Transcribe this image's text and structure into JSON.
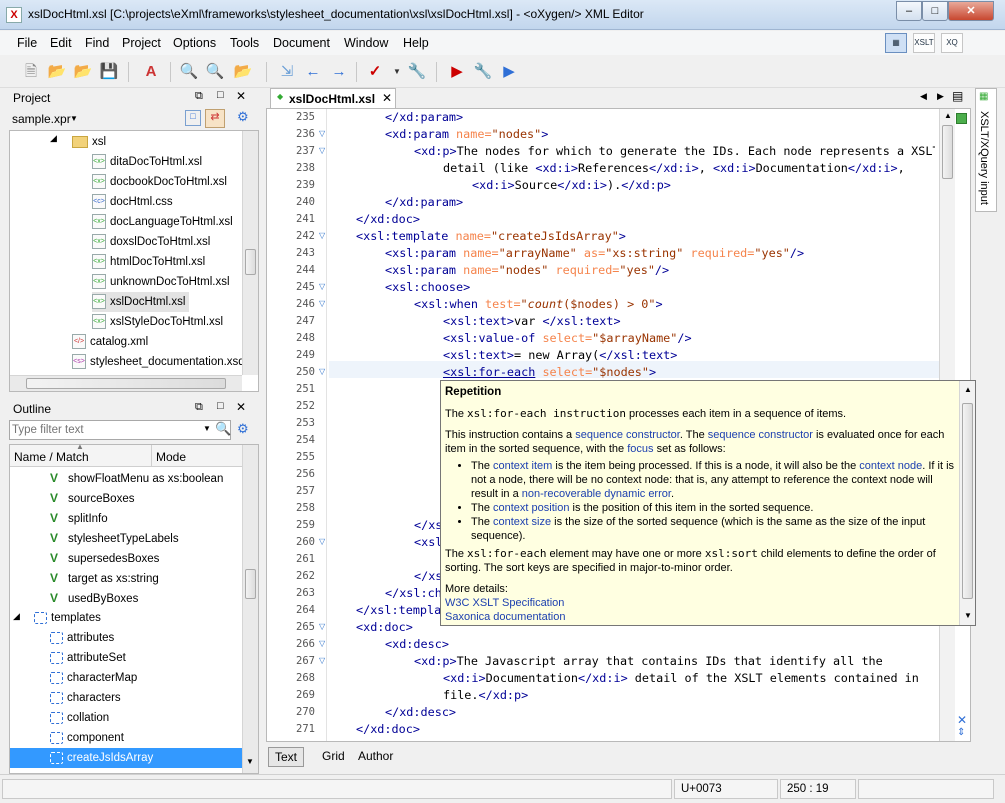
{
  "window": {
    "title": "xslDocHtml.xsl [C:\\projects\\eXml\\frameworks\\stylesheet_documentation\\xsl\\xslDocHtml.xsl] - <oXygen/> XML Editor",
    "app_icon": "x-logo-icon"
  },
  "menu": [
    "File",
    "Edit",
    "Find",
    "Project",
    "Options",
    "Tools",
    "Document",
    "Window",
    "Help"
  ],
  "perspectives": [
    "editor-perspective-icon",
    "XSLT",
    "XQ"
  ],
  "project": {
    "header": "Project",
    "file": "sample.xpr",
    "tree": [
      {
        "label": "xsl",
        "type": "folder"
      },
      {
        "label": "ditaDocToHtml.xsl",
        "type": "xsl"
      },
      {
        "label": "docbookDocToHtml.xsl",
        "type": "xsl"
      },
      {
        "label": "docHtml.css",
        "type": "css"
      },
      {
        "label": "docLanguageToHtml.xsl",
        "type": "xsl"
      },
      {
        "label": "doxslDocToHtml.xsl",
        "type": "xsl"
      },
      {
        "label": "htmlDocToHtml.xsl",
        "type": "xsl"
      },
      {
        "label": "unknownDocToHtml.xsl",
        "type": "xsl"
      },
      {
        "label": "xslDocHtml.xsl",
        "type": "xsl",
        "selected": true
      },
      {
        "label": "xslStyleDocToHtml.xsl",
        "type": "xsl"
      },
      {
        "label": "catalog.xml",
        "type": "xml"
      },
      {
        "label": "stylesheet_documentation.xsd",
        "type": "xsd"
      }
    ]
  },
  "outline": {
    "header": "Outline",
    "filter_placeholder": "Type filter text",
    "columns": [
      "Name / Match",
      "Mode"
    ],
    "items": [
      {
        "label": "showFloatMenu as xs:boolean",
        "type": "var"
      },
      {
        "label": "sourceBoxes",
        "type": "var"
      },
      {
        "label": "splitInfo",
        "type": "var"
      },
      {
        "label": "stylesheetTypeLabels",
        "type": "var"
      },
      {
        "label": "supersedesBoxes",
        "type": "var"
      },
      {
        "label": "target as xs:string",
        "type": "var"
      },
      {
        "label": "usedByBoxes",
        "type": "var"
      },
      {
        "label": "templates",
        "type": "group"
      },
      {
        "label": "attributes",
        "type": "tmpl"
      },
      {
        "label": "attributeSet",
        "type": "tmpl"
      },
      {
        "label": "characterMap",
        "type": "tmpl"
      },
      {
        "label": "characters",
        "type": "tmpl"
      },
      {
        "label": "collation",
        "type": "tmpl"
      },
      {
        "label": "component",
        "type": "tmpl"
      },
      {
        "label": "createJsIdsArray",
        "type": "tmpl",
        "selected": true
      }
    ]
  },
  "editor": {
    "tab": "xslDocHtml.xsl",
    "side_tab": "XSLT/XQuery input",
    "lines": [
      "235",
      "236",
      "237",
      "238",
      "239",
      "240",
      "241",
      "242",
      "243",
      "244",
      "245",
      "246",
      "247",
      "248",
      "249",
      "250",
      "251",
      "252",
      "253",
      "254",
      "255",
      "256",
      "257",
      "258",
      "259",
      "260",
      "261",
      "262",
      "263",
      "264",
      "265",
      "266",
      "267",
      "268",
      "269",
      "270",
      "271"
    ],
    "bottom_tabs": [
      "Text",
      "Grid",
      "Author"
    ]
  },
  "tooltip": {
    "heading": "Repetition",
    "p1_pre": "The ",
    "p1_code": "xsl:for-each instruction",
    "p1_post": " processes each item in a sequence of items.",
    "p2_a": "This instruction contains a ",
    "p2_link1": "sequence constructor",
    "p2_b": ". The ",
    "p2_link2": "sequence constructor",
    "p2_c": " is evaluated once for each item in the sorted sequence, with the ",
    "p2_link3": "focus",
    "p2_d": " set as follows:",
    "b1_a": "The ",
    "b1_link1": "context item",
    "b1_b": " is the item being processed. If this is a node, it will also be the ",
    "b1_link2": "context node",
    "b1_c": ". If it is not a node, there will be no context node: that is, any attempt to reference the context node will result in a ",
    "b1_link3": "non-recoverable dynamic error",
    "b1_d": ".",
    "b2_a": "The ",
    "b2_link": "context position",
    "b2_b": " is the position of this item in the sorted sequence.",
    "b3_a": "The ",
    "b3_link": "context size",
    "b3_b": " is the size of the sorted sequence (which is the same as the size of the input sequence).",
    "p3_code1": "xsl:for-each",
    "p3_a": " element may have one or more ",
    "p3_code2": "xsl:sort",
    "p3_b": " child elements to define the order of sorting. The sort keys are specified in major-to-minor order.",
    "p3_the": "The ",
    "more": "More details:",
    "link_w3c": "W3C XSLT Specification",
    "link_saxonica": "Saxonica documentation"
  },
  "status": {
    "unicode": "U+0073",
    "position": "250 : 19"
  }
}
